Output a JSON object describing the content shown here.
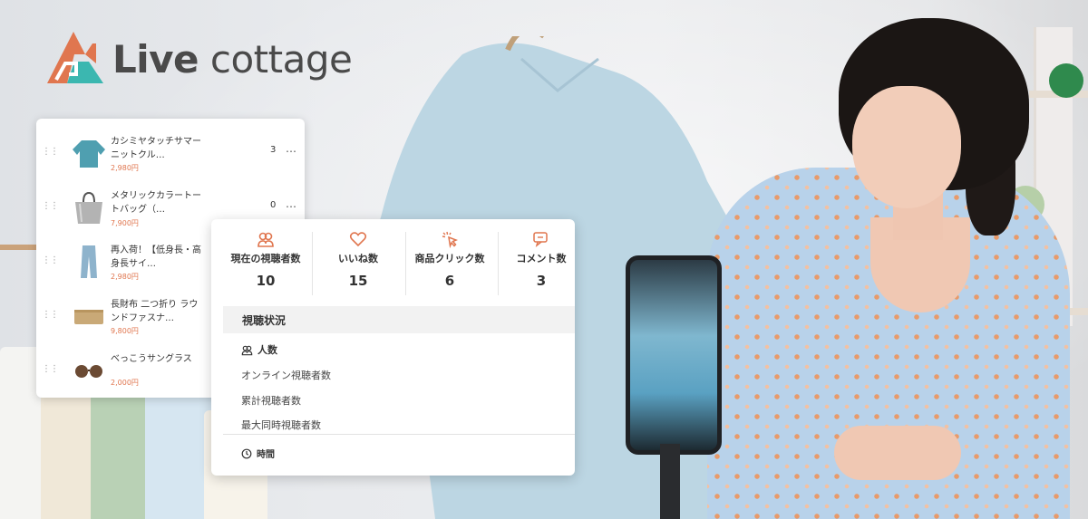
{
  "brand": {
    "name_bold": "Live",
    "name_rest": " cottage"
  },
  "products": [
    {
      "name": "カシミヤタッチサマーニットクル…",
      "price": "2,980円",
      "qty": "3",
      "more": "…",
      "thumb": "knit-sweater-icon"
    },
    {
      "name": "メタリックカラートートバッグ（…",
      "price": "7,900円",
      "qty": "0",
      "more": "…",
      "thumb": "tote-bag-icon"
    },
    {
      "name": "再入荷！【低身長・高身長サイ…",
      "price": "2,980円",
      "qty": "",
      "more": "",
      "thumb": "pants-icon"
    },
    {
      "name": "長財布 二つ折り ラウンドファスナ…",
      "price": "9,800円",
      "qty": "",
      "more": "",
      "thumb": "wallet-icon"
    },
    {
      "name": "べっこうサングラス",
      "price": "2,000円",
      "qty": "",
      "more": "",
      "thumb": "sunglasses-icon"
    }
  ],
  "stats": [
    {
      "label": "現在の視聴者数",
      "value": "10",
      "icon": "viewers-icon"
    },
    {
      "label": "いいね数",
      "value": "15",
      "icon": "heart-icon"
    },
    {
      "label": "商品クリック数",
      "value": "6",
      "icon": "click-icon"
    },
    {
      "label": "コメント数",
      "value": "3",
      "icon": "comment-icon"
    }
  ],
  "viewing": {
    "title": "視聴状況",
    "people_heading": "人数",
    "items": [
      "オンライン視聴者数",
      "累計視聴者数",
      "最大同時視聴者数"
    ],
    "time_heading": "時間"
  },
  "colors": {
    "accent": "#e0764f",
    "teal": "#3bb7b0",
    "text": "#333333"
  }
}
